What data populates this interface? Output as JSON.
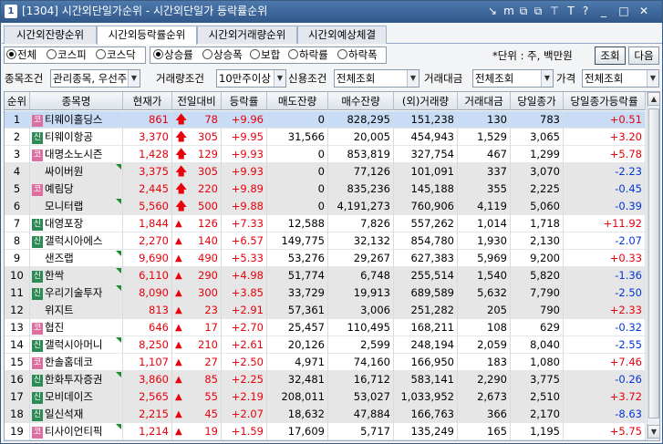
{
  "window": {
    "number": "1",
    "title": "[1304] 시간외단일가순위 - 시간외단일가 등락률순위",
    "icons": [
      "link-icon",
      "memo-icon",
      "restore-icon",
      "copy-icon",
      "pin-icon",
      "text-icon",
      "help-icon",
      "minimize-icon",
      "maximize-icon",
      "close-icon"
    ],
    "icon_glyphs": [
      "↘",
      "m",
      "⧉",
      "⧉",
      "⊤",
      "T",
      "?",
      "_",
      "□",
      "✕"
    ]
  },
  "tabs": [
    {
      "label": "시간외잔량순위",
      "active": false
    },
    {
      "label": "시간외등락률순위",
      "active": true
    },
    {
      "label": "시간외거래량순위",
      "active": false
    },
    {
      "label": "시간외예상체결",
      "active": false
    }
  ],
  "market_radios": [
    {
      "label": "전체",
      "checked": true
    },
    {
      "label": "코스피",
      "checked": false
    },
    {
      "label": "코스닥",
      "checked": false
    }
  ],
  "sort_radios": [
    {
      "label": "상승률",
      "checked": true
    },
    {
      "label": "상승폭",
      "checked": false
    },
    {
      "label": "보합",
      "checked": false
    },
    {
      "label": "하락률",
      "checked": false
    },
    {
      "label": "하락폭",
      "checked": false
    }
  ],
  "unit_text": "*단위 : 주, 백만원",
  "buttons": {
    "query": "조회",
    "next": "다음"
  },
  "filters": {
    "item_label": "종목조건",
    "item_value": "관리종목, 우선주",
    "volume_label": "거래량조건",
    "volume_value": "10만주이상",
    "credit_label": "신용조건",
    "credit_value": "전체조회",
    "amount_label": "거래대금",
    "amount_value": "전체조회",
    "price_label": "가격",
    "price_value": "전체조회"
  },
  "columns": [
    "순위",
    "종목명",
    "현재가",
    "전일대비",
    "등락률",
    "매도잔량",
    "매수잔량",
    "(외)거래량",
    "거래대금",
    "당일종가",
    "당일종가등락률"
  ],
  "colors": {
    "up": "#e8000b",
    "down": "#0035d9",
    "selected_row": "#c9dcf5",
    "alt_row": "#e6e6e6"
  },
  "rows": [
    {
      "rank": "1",
      "badge": "코",
      "name": "티웨이홀딩스",
      "price": "861",
      "arrow": "limit",
      "change": "78",
      "rate": "+9.96",
      "ask": "0",
      "bid": "828,295",
      "vol": "151,238",
      "amount": "130",
      "close": "783",
      "close_rate": "+0.51",
      "close_dir": "up",
      "tri": false
    },
    {
      "rank": "2",
      "badge": "신",
      "name": "티웨이항공",
      "price": "3,370",
      "arrow": "limit",
      "change": "305",
      "rate": "+9.95",
      "ask": "31,566",
      "bid": "20,005",
      "vol": "454,943",
      "amount": "1,529",
      "close": "3,065",
      "close_rate": "+3.20",
      "close_dir": "up",
      "tri": false
    },
    {
      "rank": "3",
      "badge": "코",
      "name": "대명소노시즌",
      "price": "1,428",
      "arrow": "limit",
      "change": "129",
      "rate": "+9.93",
      "ask": "0",
      "bid": "853,819",
      "vol": "327,754",
      "amount": "467",
      "close": "1,299",
      "close_rate": "+5.78",
      "close_dir": "up",
      "tri": false
    },
    {
      "rank": "4",
      "badge": "",
      "name": "싸이버원",
      "price": "3,375",
      "arrow": "limit",
      "change": "305",
      "rate": "+9.93",
      "ask": "0",
      "bid": "77,126",
      "vol": "101,091",
      "amount": "337",
      "close": "3,070",
      "close_rate": "-2.23",
      "close_dir": "down",
      "tri": true
    },
    {
      "rank": "5",
      "badge": "코",
      "name": "예림당",
      "price": "2,445",
      "arrow": "limit",
      "change": "220",
      "rate": "+9.89",
      "ask": "0",
      "bid": "835,236",
      "vol": "145,188",
      "amount": "355",
      "close": "2,225",
      "close_rate": "-0.45",
      "close_dir": "down",
      "tri": false
    },
    {
      "rank": "6",
      "badge": "",
      "name": "모니터랩",
      "price": "5,560",
      "arrow": "limit",
      "change": "500",
      "rate": "+9.88",
      "ask": "0",
      "bid": "4,191,273",
      "vol": "760,906",
      "amount": "4,119",
      "close": "5,060",
      "close_rate": "-0.39",
      "close_dir": "down",
      "tri": true
    },
    {
      "rank": "7",
      "badge": "신",
      "name": "대영포장",
      "price": "1,844",
      "arrow": "up",
      "change": "126",
      "rate": "+7.33",
      "ask": "12,588",
      "bid": "7,826",
      "vol": "557,262",
      "amount": "1,014",
      "close": "1,718",
      "close_rate": "+11.92",
      "close_dir": "up",
      "tri": false
    },
    {
      "rank": "8",
      "badge": "신",
      "name": "갤럭시아에스",
      "price": "2,270",
      "arrow": "up",
      "change": "140",
      "rate": "+6.57",
      "ask": "149,775",
      "bid": "32,132",
      "vol": "854,780",
      "amount": "1,930",
      "close": "2,130",
      "close_rate": "-2.07",
      "close_dir": "down",
      "tri": false
    },
    {
      "rank": "9",
      "badge": "",
      "name": "샌즈랩",
      "price": "9,690",
      "arrow": "up",
      "change": "490",
      "rate": "+5.33",
      "ask": "53,276",
      "bid": "29,267",
      "vol": "627,383",
      "amount": "5,969",
      "close": "9,200",
      "close_rate": "+0.33",
      "close_dir": "up",
      "tri": true
    },
    {
      "rank": "10",
      "badge": "신",
      "name": "한싹",
      "price": "6,110",
      "arrow": "up",
      "change": "290",
      "rate": "+4.98",
      "ask": "51,774",
      "bid": "6,748",
      "vol": "255,514",
      "amount": "1,540",
      "close": "5,820",
      "close_rate": "-1.36",
      "close_dir": "down",
      "tri": true
    },
    {
      "rank": "11",
      "badge": "신",
      "name": "우리기술투자",
      "price": "8,090",
      "arrow": "up",
      "change": "300",
      "rate": "+3.85",
      "ask": "33,729",
      "bid": "19,913",
      "vol": "689,589",
      "amount": "5,632",
      "close": "7,790",
      "close_rate": "-2.50",
      "close_dir": "down",
      "tri": true
    },
    {
      "rank": "12",
      "badge": "",
      "name": "위지트",
      "price": "813",
      "arrow": "up",
      "change": "23",
      "rate": "+2.91",
      "ask": "57,361",
      "bid": "3,006",
      "vol": "251,282",
      "amount": "205",
      "close": "790",
      "close_rate": "+2.33",
      "close_dir": "up",
      "tri": false
    },
    {
      "rank": "13",
      "badge": "코",
      "name": "협진",
      "price": "646",
      "arrow": "up",
      "change": "17",
      "rate": "+2.70",
      "ask": "25,457",
      "bid": "110,495",
      "vol": "168,211",
      "amount": "108",
      "close": "629",
      "close_rate": "-0.32",
      "close_dir": "down",
      "tri": false
    },
    {
      "rank": "14",
      "badge": "신",
      "name": "갤럭시아머니",
      "price": "8,250",
      "arrow": "up",
      "change": "210",
      "rate": "+2.61",
      "ask": "20,126",
      "bid": "2,599",
      "vol": "248,194",
      "amount": "2,059",
      "close": "8,040",
      "close_rate": "-2.55",
      "close_dir": "down",
      "tri": true
    },
    {
      "rank": "15",
      "badge": "코",
      "name": "한솔홈데코",
      "price": "1,107",
      "arrow": "up",
      "change": "27",
      "rate": "+2.50",
      "ask": "4,971",
      "bid": "74,160",
      "vol": "166,950",
      "amount": "183",
      "close": "1,080",
      "close_rate": "+7.46",
      "close_dir": "up",
      "tri": false
    },
    {
      "rank": "16",
      "badge": "신",
      "name": "한화투자증권",
      "price": "3,860",
      "arrow": "up",
      "change": "85",
      "rate": "+2.25",
      "ask": "32,481",
      "bid": "16,712",
      "vol": "583,141",
      "amount": "2,290",
      "close": "3,775",
      "close_rate": "-0.26",
      "close_dir": "down",
      "tri": true
    },
    {
      "rank": "17",
      "badge": "신",
      "name": "모비데이즈",
      "price": "2,565",
      "arrow": "up",
      "change": "55",
      "rate": "+2.19",
      "ask": "208,011",
      "bid": "53,027",
      "vol": "1,033,952",
      "amount": "2,673",
      "close": "2,510",
      "close_rate": "+3.72",
      "close_dir": "up",
      "tri": false
    },
    {
      "rank": "18",
      "badge": "신",
      "name": "일신석재",
      "price": "2,215",
      "arrow": "up",
      "change": "45",
      "rate": "+2.07",
      "ask": "18,632",
      "bid": "47,884",
      "vol": "166,763",
      "amount": "366",
      "close": "2,170",
      "close_rate": "-8.63",
      "close_dir": "down",
      "tri": false
    },
    {
      "rank": "19",
      "badge": "코",
      "name": "티사이언티픽",
      "price": "1,214",
      "arrow": "up",
      "change": "19",
      "rate": "+1.59",
      "ask": "17,609",
      "bid": "5,717",
      "vol": "135,249",
      "amount": "165",
      "close": "1,195",
      "close_rate": "+5.75",
      "close_dir": "up",
      "tri": true
    },
    {
      "rank": "20",
      "badge": "신",
      "name": "쏠리드",
      "price": "6,840",
      "arrow": "up",
      "change": "90",
      "rate": "+1.33",
      "ask": "26,695",
      "bid": "32,097",
      "vol": "135,723",
      "amount": "925",
      "close": "6,750",
      "close_rate": "-4.93",
      "close_dir": "down",
      "tri": true
    }
  ]
}
